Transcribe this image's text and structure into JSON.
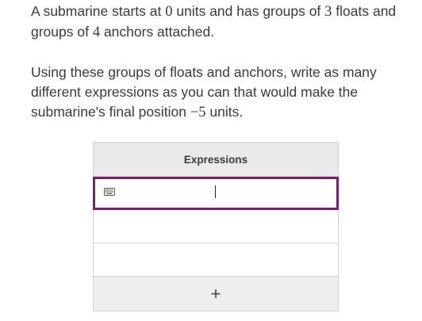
{
  "prompt": {
    "p1_a": "A submarine starts at ",
    "p1_math1": "0",
    "p1_b": " units and has groups of ",
    "p1_math2": "3",
    "p1_c": " floats and groups of ",
    "p1_math3": "4",
    "p1_d": " anchors attached.",
    "p2_a": "Using these groups of floats and anchors, write as many different expressions as you can that would make the submarine's final position ",
    "p2_math": "−5",
    "p2_b": " units."
  },
  "table": {
    "header": "Expressions",
    "rows": [
      "",
      "",
      ""
    ],
    "add_label": "+"
  },
  "icons": {
    "keyboard": "keyboard-icon",
    "add": "plus-icon"
  },
  "colors": {
    "active_border": "#7b1f6e",
    "header_bg": "#eaeaea",
    "add_bg": "#eeeeee"
  }
}
